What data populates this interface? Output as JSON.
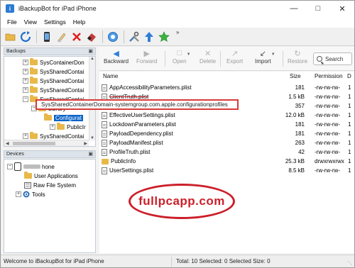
{
  "window": {
    "title": "iBackupBot for iPad iPhone",
    "app_icon_letter": "i"
  },
  "menu": [
    "File",
    "View",
    "Settings",
    "Help"
  ],
  "toolbar": {
    "icons": [
      "folder-open-icon",
      "refresh-icon",
      "device-icon",
      "clean-icon",
      "delete-icon",
      "eraser-icon",
      "info-icon",
      "tools-icon",
      "upload-icon",
      "star-icon"
    ],
    "overflow": "»"
  },
  "backups_panel": {
    "title": "Backups",
    "pin": "ᵖ",
    "nodes": [
      {
        "label": "SysContainerDon",
        "expander": "+"
      },
      {
        "label": "SysSharedContai",
        "expander": "+"
      },
      {
        "label": "SysSharedContai",
        "expander": "+"
      },
      {
        "label": "SysSharedContai",
        "expander": "+"
      },
      {
        "label": "SysSharedContai",
        "expander": "−"
      },
      {
        "label": "Library",
        "expander": "−"
      },
      {
        "label": "Configurat",
        "expander": ""
      },
      {
        "label": "PublicIr",
        "expander": "+"
      },
      {
        "label": "SysSharedContai",
        "expander": "+"
      }
    ]
  },
  "devices_panel": {
    "title": "Devices",
    "pin": "ᵖ",
    "device_name_suffix": "hone",
    "items": [
      "User Applications",
      "Raw File System",
      "Tools"
    ]
  },
  "file_toolbar": {
    "backward": "Backward",
    "forward": "Forward",
    "open": "Open",
    "delete": "Delete",
    "export": "Export",
    "import": "Import",
    "restore": "Restore",
    "search_placeholder": "Search"
  },
  "file_list": {
    "columns": {
      "name": "Name",
      "size": "Size",
      "permission": "Permission",
      "d": "D"
    },
    "rows": [
      {
        "name": "AppAccessibilityParameters.plist",
        "size": "181",
        "perm": "-rw-rw-rw-",
        "d": "1",
        "type": "file"
      },
      {
        "name": "ClientTruth.plist",
        "size": "1.5 kB",
        "perm": "-rw-rw-rw-",
        "d": "1",
        "type": "file"
      },
      {
        "name": "",
        "size": "357",
        "perm": "-rw-rw-rw-",
        "d": "1",
        "type": "file"
      },
      {
        "name": "EffectiveUserSettings.plist",
        "size": "12.0 kB",
        "perm": "-rw-rw-rw-",
        "d": "1",
        "type": "file"
      },
      {
        "name": "LockdownParameters.plist",
        "size": "181",
        "perm": "-rw-rw-rw-",
        "d": "1",
        "type": "file"
      },
      {
        "name": "PayloadDependency.plist",
        "size": "181",
        "perm": "-rw-rw-rw-",
        "d": "1",
        "type": "file"
      },
      {
        "name": "PayloadManifest.plist",
        "size": "263",
        "perm": "-rw-rw-rw-",
        "d": "1",
        "type": "file"
      },
      {
        "name": "ProfileTruth.plist",
        "size": "42",
        "perm": "-rw-rw-rw-",
        "d": "1",
        "type": "file"
      },
      {
        "name": "PublicInfo",
        "size": "25.3 kB",
        "perm": "drwxrwxrwx",
        "d": "1",
        "type": "folder"
      },
      {
        "name": "UserSettings.plist",
        "size": "8.5 kB",
        "perm": "-rw-rw-rw-",
        "d": "1",
        "type": "file"
      }
    ]
  },
  "highlight_path": "SysSharedContainerDomain-systemgroup.com.apple.configurationprofiles",
  "watermark": "fullpcapp.com",
  "status": {
    "left": "Welcome to iBackupBot for iPad iPhone",
    "right": "Total: 10 Selected: 0 Selected Size: 0"
  },
  "colors": {
    "selection": "#0a64c8",
    "annotation_red": "#cc1f2a",
    "folder": "#e8b84a"
  }
}
